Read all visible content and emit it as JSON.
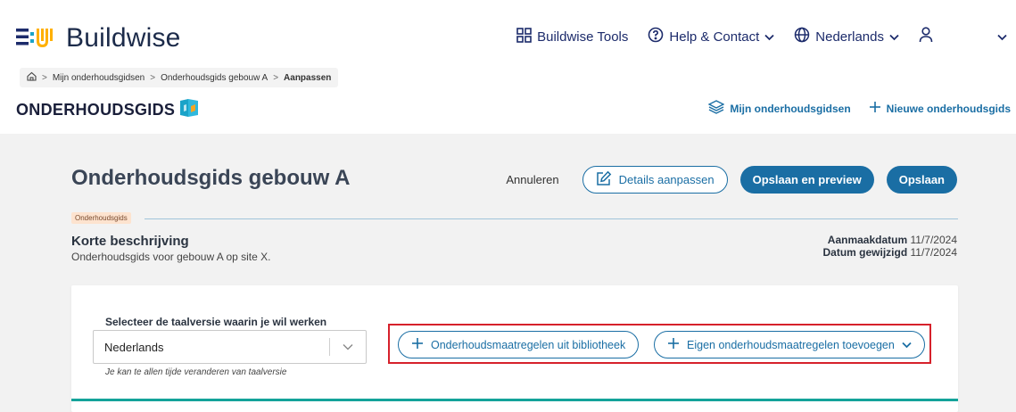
{
  "header": {
    "logo_text": "Buildwise",
    "nav": {
      "tools": "Buildwise Tools",
      "help": "Help & Contact",
      "language": "Nederlands"
    }
  },
  "breadcrumb": {
    "items": [
      "Mijn onderhoudsgidsen",
      "Onderhoudsgids gebouw A",
      "Aanpassen"
    ]
  },
  "brand": {
    "title": "ONDERHOUDSGIDS"
  },
  "sublinks": {
    "my_guides": "Mijn onderhoudsgidsen",
    "new_guide": "Nieuwe onderhoudsgids"
  },
  "page": {
    "title": "Onderhoudsgids gebouw A",
    "actions": {
      "cancel": "Annuleren",
      "edit_details": "Details aanpassen",
      "save_preview": "Opslaan en preview",
      "save": "Opslaan"
    },
    "tag": "Onderhoudsgids",
    "description_title": "Korte beschrijving",
    "description_text": "Onderhoudsgids voor gebouw A op site X.",
    "dates": {
      "created_label": "Aanmaakdatum",
      "created_value": "11/7/2024",
      "modified_label": "Datum gewijzigd",
      "modified_value": "11/7/2024"
    }
  },
  "language_panel": {
    "label": "Selecteer de taalversie waarin je wil werken",
    "selected": "Nederlands",
    "hint": "Je kan te allen tijde veranderen van taalversie"
  },
  "measures": {
    "from_library": "Onderhoudsmaatregelen uit bibliotheek",
    "add_own": "Eigen onderhoudsmaatregelen toevoegen"
  },
  "colors": {
    "primary": "#1a6ea4",
    "navy": "#1c2b6b",
    "teal": "#14a39a",
    "highlight": "#d6212b"
  }
}
